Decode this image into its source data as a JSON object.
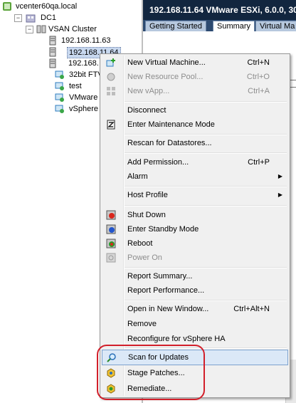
{
  "tree": {
    "vcenter": "vcenter60qa.local",
    "datacenter": "DC1",
    "cluster": "VSAN Cluster",
    "host_1": "192.168.11.63",
    "host_2": "192.168.11.64",
    "host_3": "192.168.",
    "vm_1": "32bit FTV",
    "vm_2": "test",
    "vm_3": "VMware v",
    "vm_4": "vSphere I"
  },
  "header": {
    "title": "192.168.11.64 VMware ESXi, 6.0.0, 30",
    "tabs": [
      "Getting Started",
      "Summary",
      "Virtual Ma"
    ]
  },
  "context_menu": {
    "new_vm": {
      "label": "New Virtual Machine...",
      "shortcut": "Ctrl+N"
    },
    "new_pool": {
      "label": "New Resource Pool...",
      "shortcut": "Ctrl+O"
    },
    "new_vapp": {
      "label": "New vApp...",
      "shortcut": "Ctrl+A"
    },
    "disconnect": {
      "label": "Disconnect"
    },
    "maintenance": {
      "label": "Enter Maintenance Mode"
    },
    "rescan": {
      "label": "Rescan for Datastores..."
    },
    "add_permission": {
      "label": "Add Permission...",
      "shortcut": "Ctrl+P"
    },
    "alarm": {
      "label": "Alarm"
    },
    "host_profile": {
      "label": "Host Profile"
    },
    "shutdown": {
      "label": "Shut Down"
    },
    "standby": {
      "label": "Enter Standby Mode"
    },
    "reboot": {
      "label": "Reboot"
    },
    "power_on": {
      "label": "Power On"
    },
    "report_summary": {
      "label": "Report Summary..."
    },
    "report_performance": {
      "label": "Report Performance..."
    },
    "open_new_window": {
      "label": "Open in New Window...",
      "shortcut": "Ctrl+Alt+N"
    },
    "remove": {
      "label": "Remove"
    },
    "reconfigure_ha": {
      "label": "Reconfigure for vSphere HA"
    },
    "scan_updates": {
      "label": "Scan for Updates"
    },
    "stage_patches": {
      "label": "Stage Patches..."
    },
    "remediate": {
      "label": "Remediate..."
    }
  },
  "colors": {
    "header_bg": "#12263f",
    "highlight": "#dbe8f7",
    "callout_ring": "#d21f2a"
  }
}
